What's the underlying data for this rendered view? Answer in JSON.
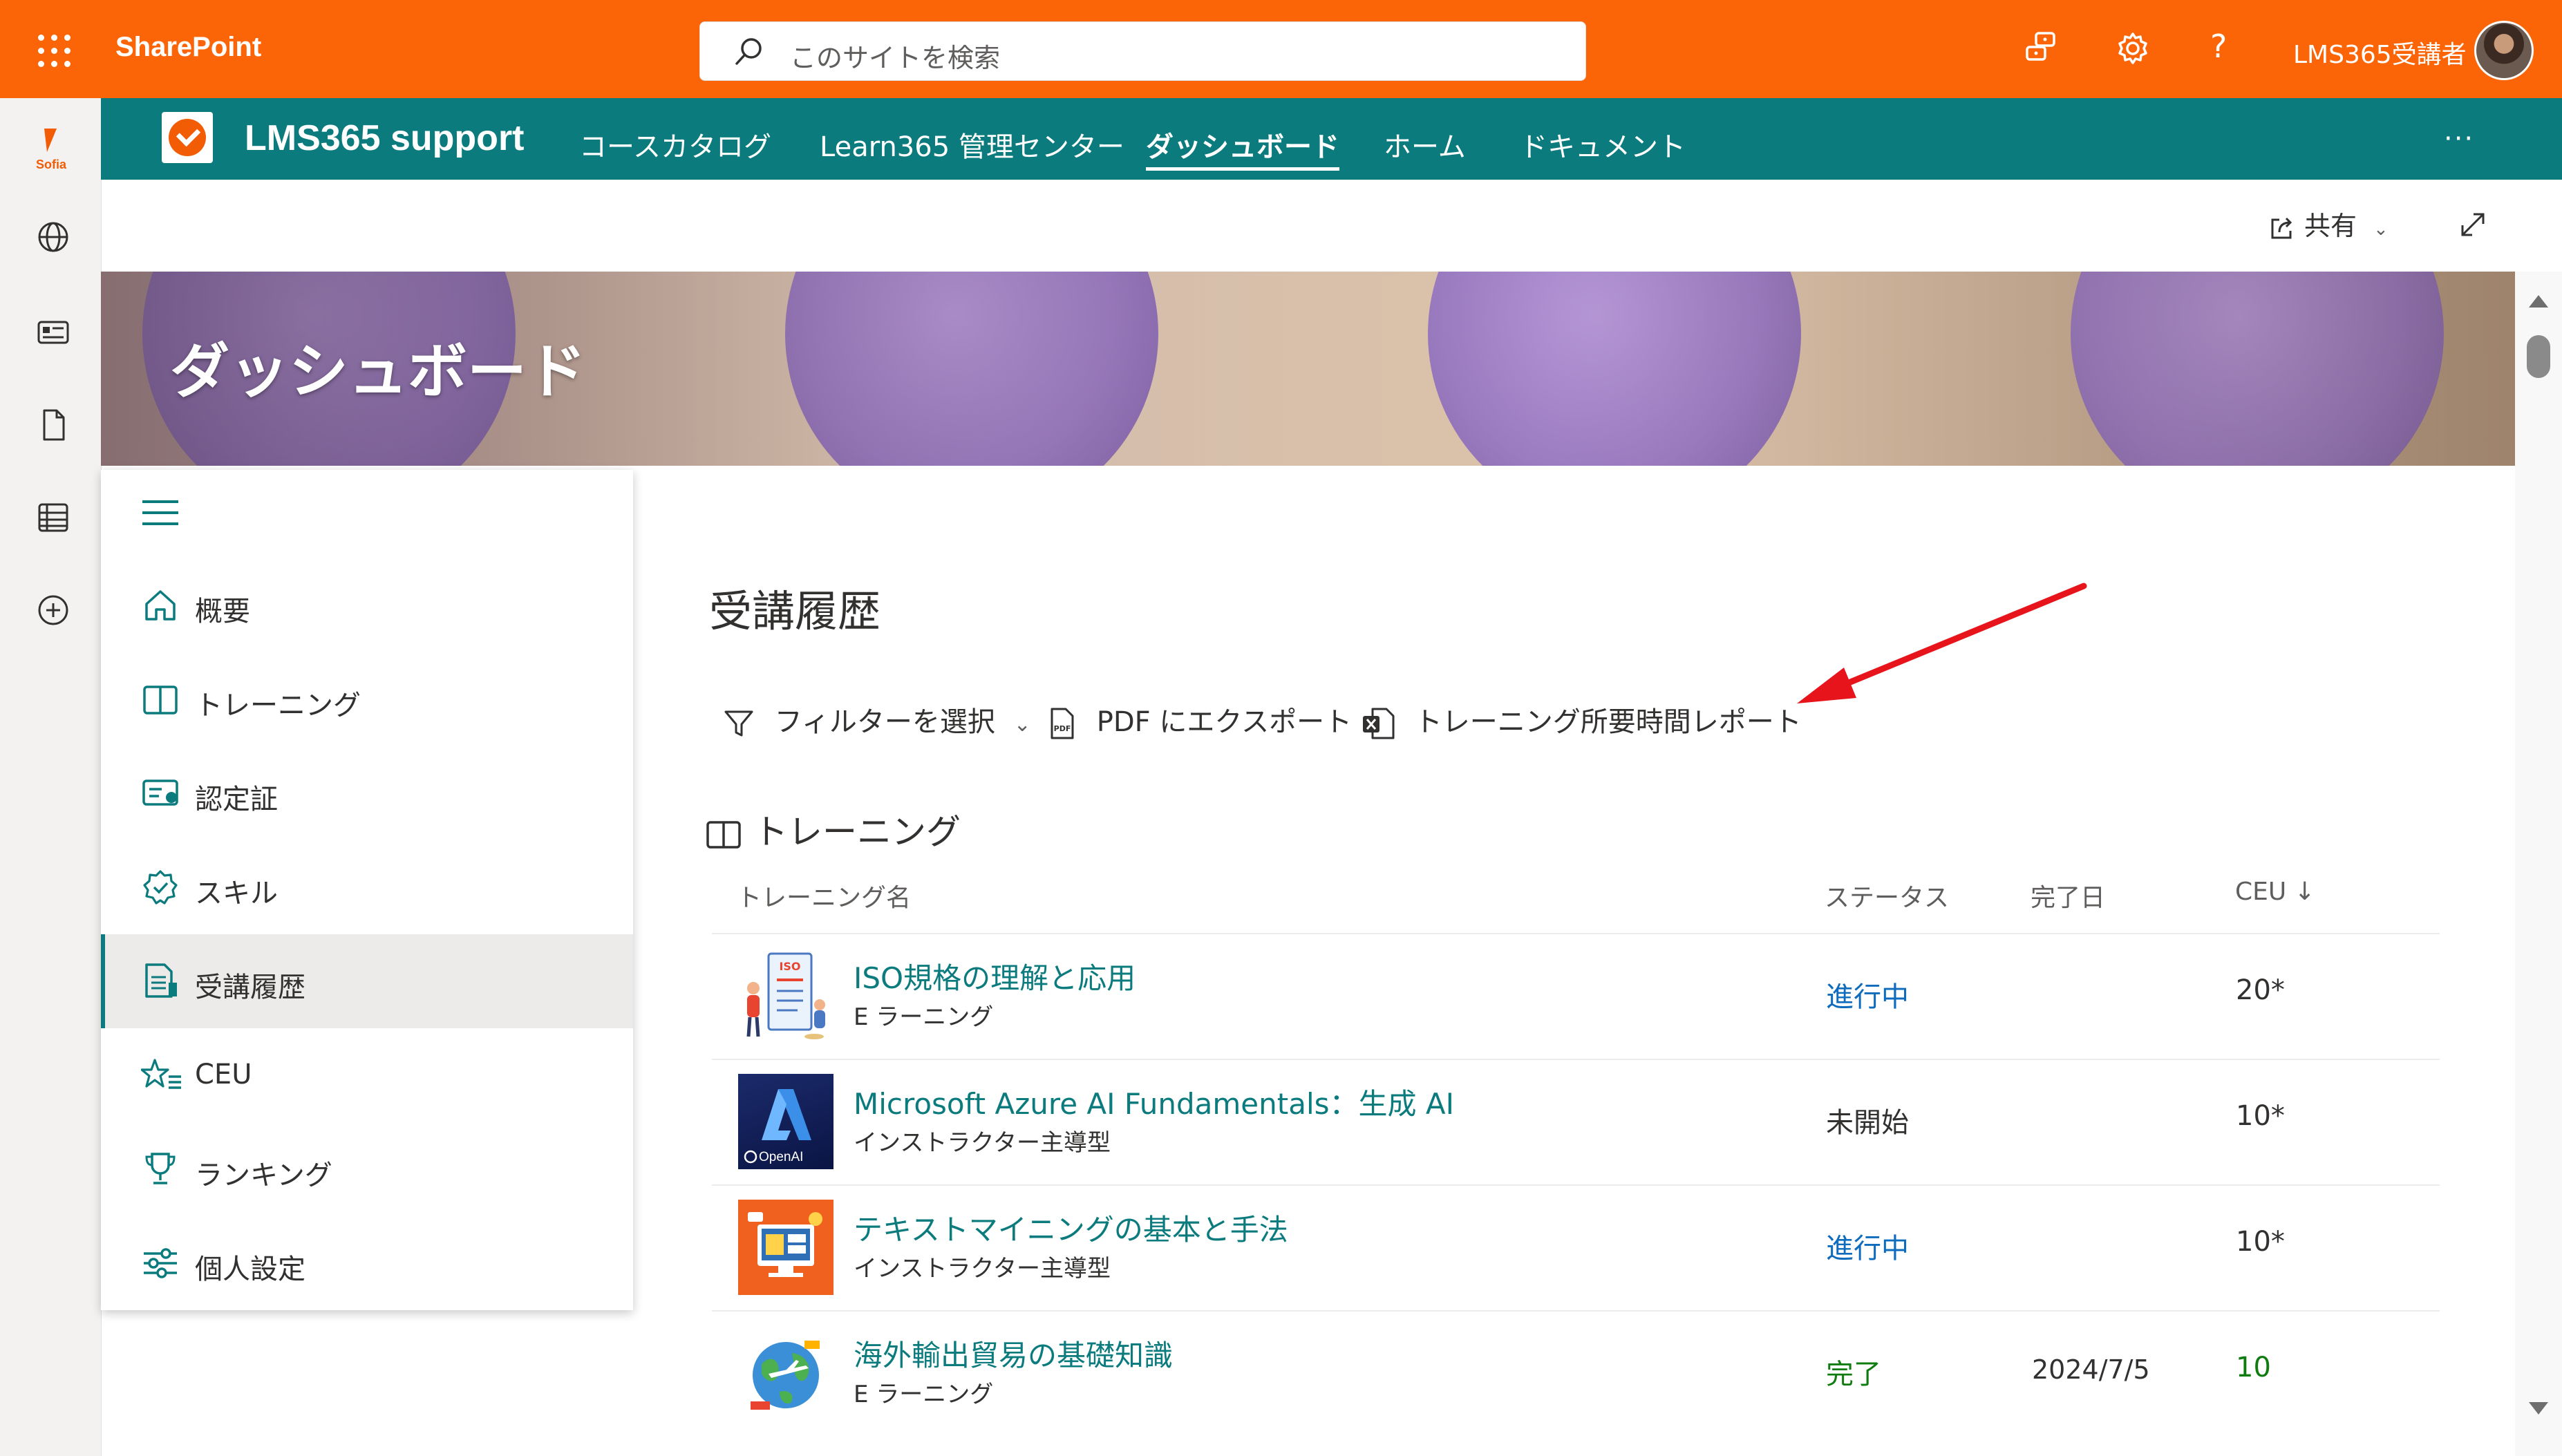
{
  "suite": {
    "brand": "SharePoint",
    "search_placeholder": "このサイトを検索",
    "user_name": "LMS365受講者"
  },
  "rail": {
    "sofia_label": "Sofia"
  },
  "site": {
    "title": "LMS365 support",
    "nav": [
      "コースカタログ",
      "Learn365 管理センター",
      "ダッシュボード",
      "ホーム",
      "ドキュメント"
    ],
    "active_nav": "ダッシュボード",
    "more": "···"
  },
  "command": {
    "share_label": "共有"
  },
  "banner": {
    "title": "ダッシュボード"
  },
  "sidemenu": {
    "items": [
      {
        "label": "概要",
        "icon": "home-icon"
      },
      {
        "label": "トレーニング",
        "icon": "book-icon"
      },
      {
        "label": "認定証",
        "icon": "certificate-icon"
      },
      {
        "label": "スキル",
        "icon": "badge-icon"
      },
      {
        "label": "受講履歴",
        "icon": "history-icon",
        "active": true
      },
      {
        "label": "CEU",
        "icon": "star-list-icon"
      },
      {
        "label": "ランキング",
        "icon": "trophy-icon"
      },
      {
        "label": "個人設定",
        "icon": "sliders-icon"
      }
    ]
  },
  "main": {
    "title": "受講履歴",
    "toolbar": {
      "filter_label": "フィルターを選択",
      "pdf_label": "PDF にエクスポート",
      "report_label": "トレーニング所要時間レポート"
    },
    "section_title": "トレーニング",
    "columns": {
      "name": "トレーニング名",
      "status": "ステータス",
      "completed": "完了日",
      "ceu": "CEU ↓"
    },
    "rows": [
      {
        "name": "ISO規格の理解と応用",
        "type": "E ラーニング",
        "status": "進行中",
        "status_color": "#0f6cbd",
        "date": "",
        "ceu": "20*",
        "ceu_color": "#323130"
      },
      {
        "name": "Microsoft Azure AI Fundamentals：生成 AI",
        "type": "インストラクター主導型",
        "status": "未開始",
        "status_color": "#323130",
        "date": "",
        "ceu": "10*",
        "ceu_color": "#323130",
        "thumb_text": "OpenAI"
      },
      {
        "name": "テキストマイニングの基本と手法",
        "type": "インストラクター主導型",
        "status": "進行中",
        "status_color": "#0f6cbd",
        "date": "",
        "ceu": "10*",
        "ceu_color": "#323130"
      },
      {
        "name": "海外輸出貿易の基礎知識",
        "type": "E ラーニング",
        "status": "完了",
        "status_color": "#107c10",
        "date": "2024/7/5",
        "ceu": "10",
        "ceu_color": "#107c10"
      }
    ]
  },
  "colors": {
    "suite_orange": "#fb6507",
    "site_teal": "#0c7b7e",
    "link_teal": "#0c7b7e",
    "annotation_red": "#e8141b"
  }
}
